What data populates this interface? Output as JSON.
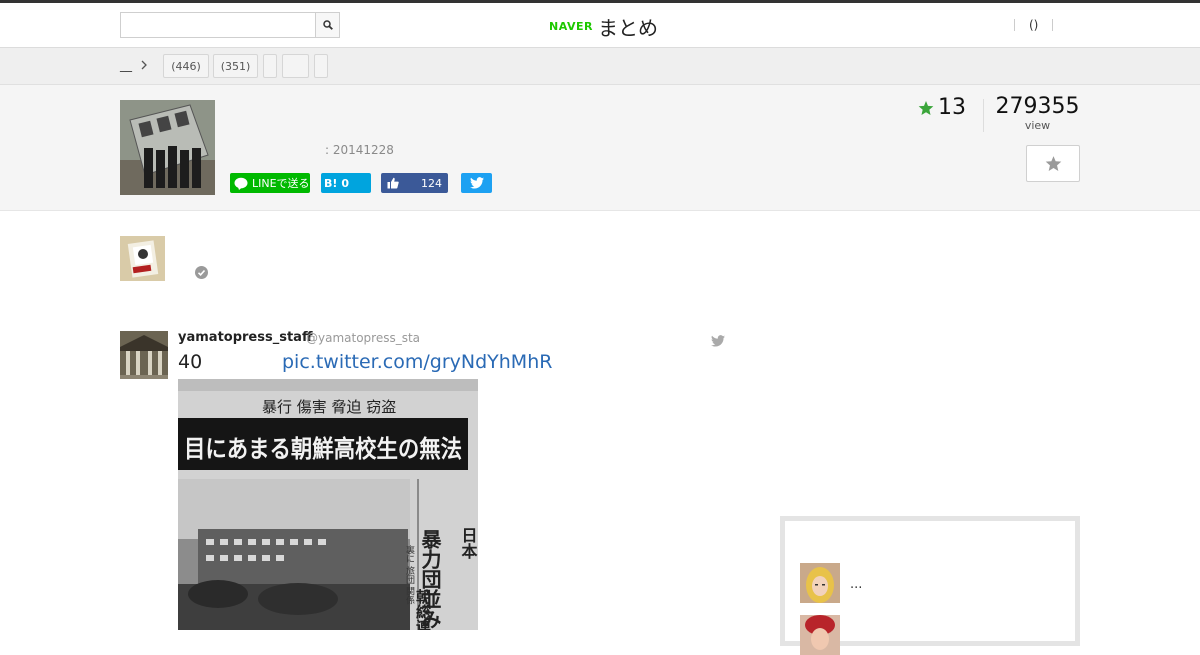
{
  "header": {
    "search_placeholder": "",
    "logo_brand": "NAVER",
    "logo_service": "まとめ",
    "user_link": "()"
  },
  "breadcrumb": {
    "home_label": "__",
    "tags": [
      {
        "label": "(446)"
      },
      {
        "label": "(351)"
      },
      {
        "label": ""
      },
      {
        "label": ""
      },
      {
        "label": ""
      }
    ]
  },
  "summary": {
    "date": ": 20141228",
    "favorites": "13",
    "views": "279355",
    "views_label": "view",
    "share": {
      "line_label": "LINEで送る",
      "hatena_label": "B!",
      "hatena_count": "0",
      "facebook_count": "124"
    }
  },
  "tweet": {
    "name": "yamatopress_staff",
    "handle": "@yamatopress_sta",
    "text": "40",
    "link": "pic.twitter.com/gryNdYhMhR",
    "image_headline": "目にあまる朝鮮高校生の無法",
    "image_kicker": "暴行 傷害 脅迫 窃盗",
    "image_side_title": "暴力団並みの",
    "image_side_small": "裏に\n旅団\n関係",
    "image_side_sub": "朝総連"
  },
  "sidebar": {
    "items": [
      {
        "text": "..."
      },
      {
        "text": ""
      }
    ]
  },
  "colors": {
    "naver_green": "#1ec800",
    "line_green": "#00b900",
    "hatena_blue": "#00a4de",
    "facebook_blue": "#3b5998",
    "twitter_blue": "#1da1f2",
    "star_green": "#3aa53a",
    "link_blue": "#2a6ab5"
  }
}
